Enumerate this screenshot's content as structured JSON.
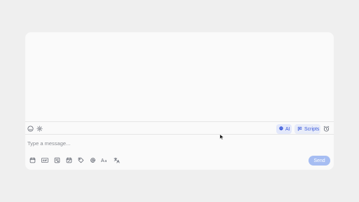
{
  "composer": {
    "placeholder": "Type a message...",
    "value": ""
  },
  "toolbar_top": {
    "left_icons": [
      "emoji-icon",
      "settings-icon"
    ],
    "ai_label": "AI",
    "scripts_label": "Scripts",
    "right_icon": "alarm-clock-icon"
  },
  "toolbar_bottom": {
    "icons": [
      "calendar-icon",
      "gif-icon",
      "article-icon",
      "calendar-edit-icon",
      "tag-icon",
      "mention-icon",
      "text-format-icon",
      "translate-icon"
    ],
    "send_label": "Send"
  },
  "colors": {
    "background": "#efefef",
    "panel": "#fafafa",
    "accent": "#3b5bdb",
    "ai_pill_bg": "#e3e8fb",
    "send_disabled": "#a6bdf2",
    "icon": "#5a5f6a"
  }
}
